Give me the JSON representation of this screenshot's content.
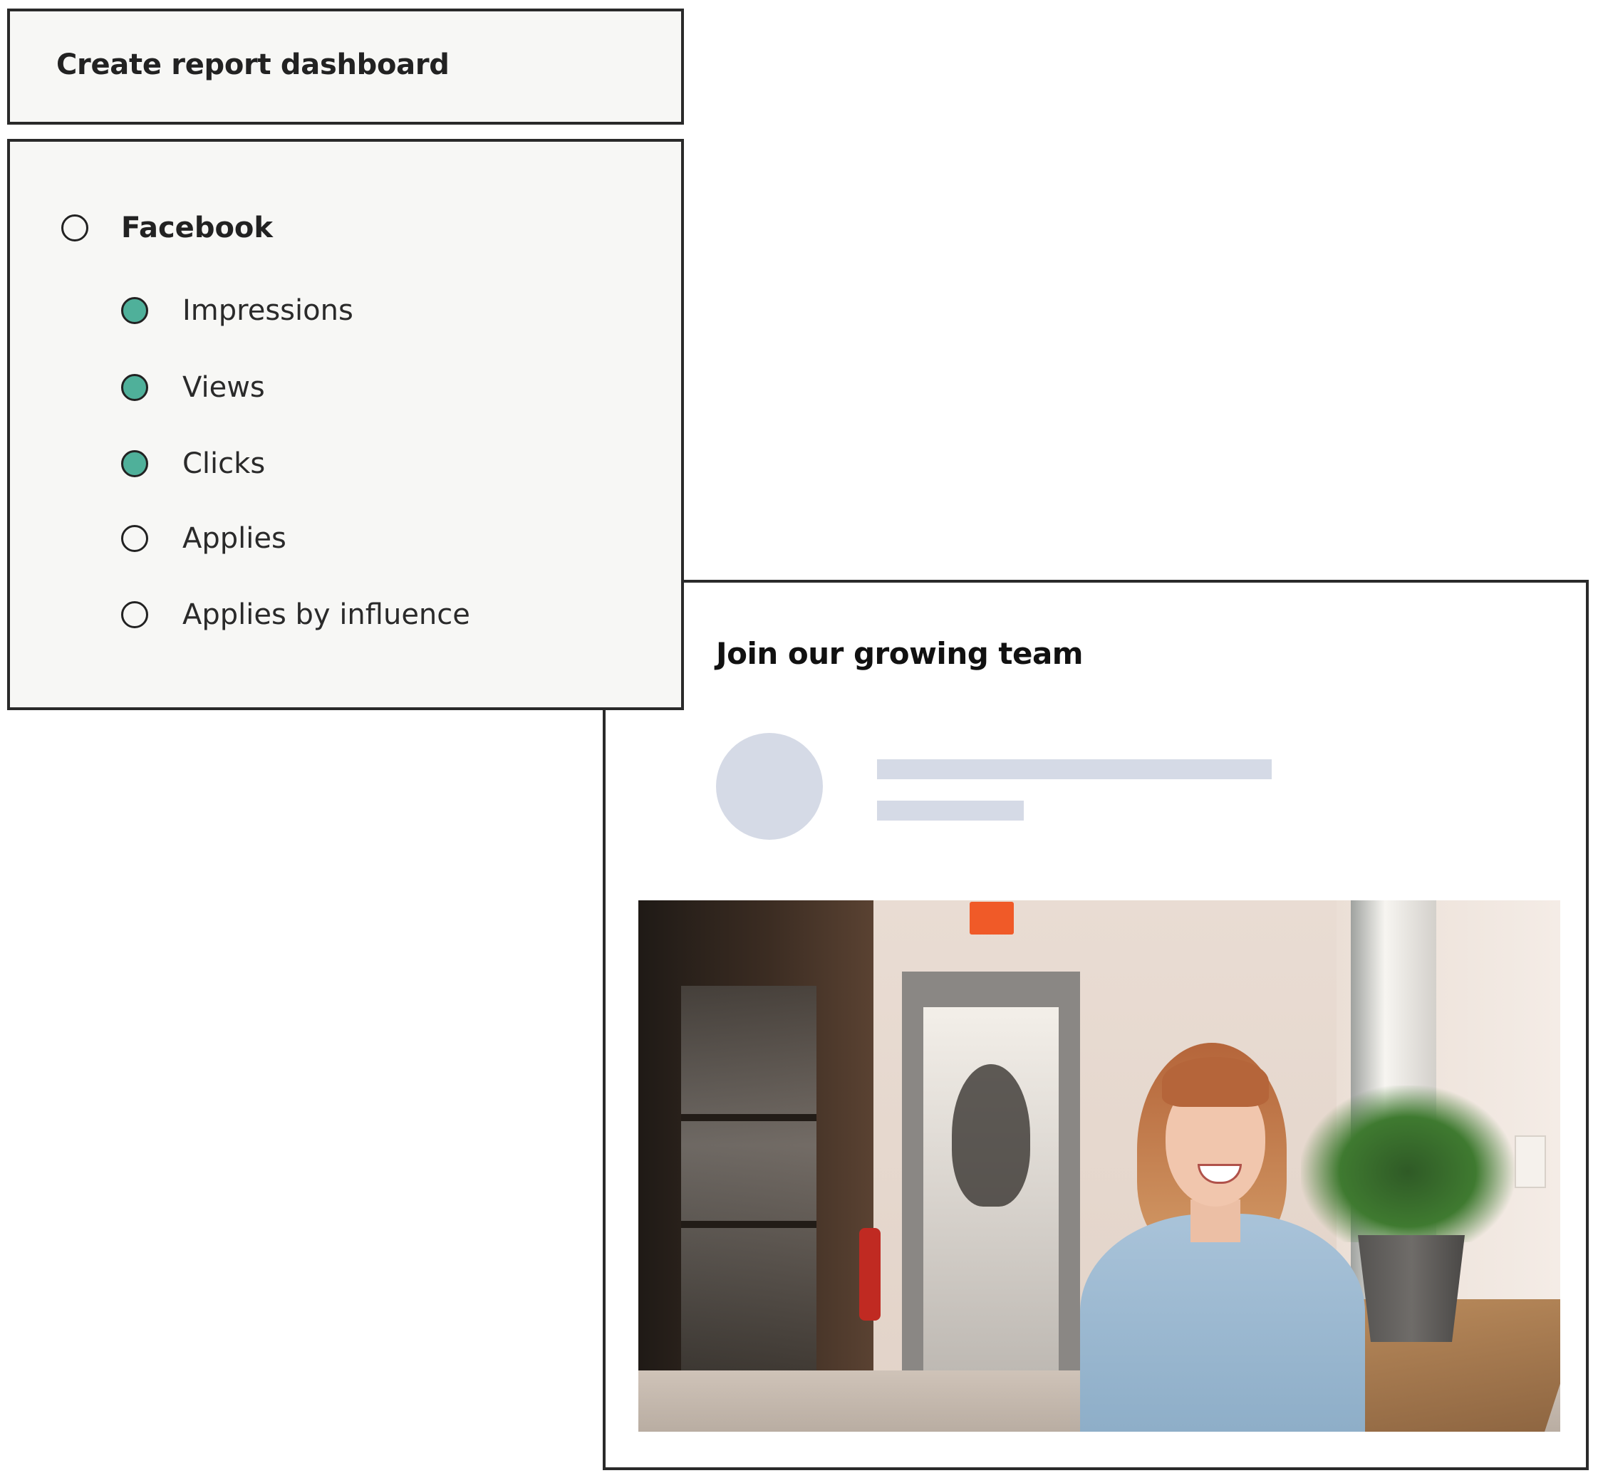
{
  "dashboard": {
    "title": "Create report dashboard",
    "group": {
      "label": "Facebook",
      "checked": false
    },
    "metrics": [
      {
        "label": "Impressions",
        "checked": true
      },
      {
        "label": "Views",
        "checked": true
      },
      {
        "label": "Clicks",
        "checked": true
      },
      {
        "label": "Applies",
        "checked": false
      },
      {
        "label": "Applies by influence",
        "checked": false
      }
    ]
  },
  "post": {
    "title": "Join our growing team"
  },
  "colors": {
    "accent": "#4fb09a",
    "border": "#2a2a2a",
    "panel_background": "#f7f7f5",
    "placeholder": "#d5dae6"
  }
}
